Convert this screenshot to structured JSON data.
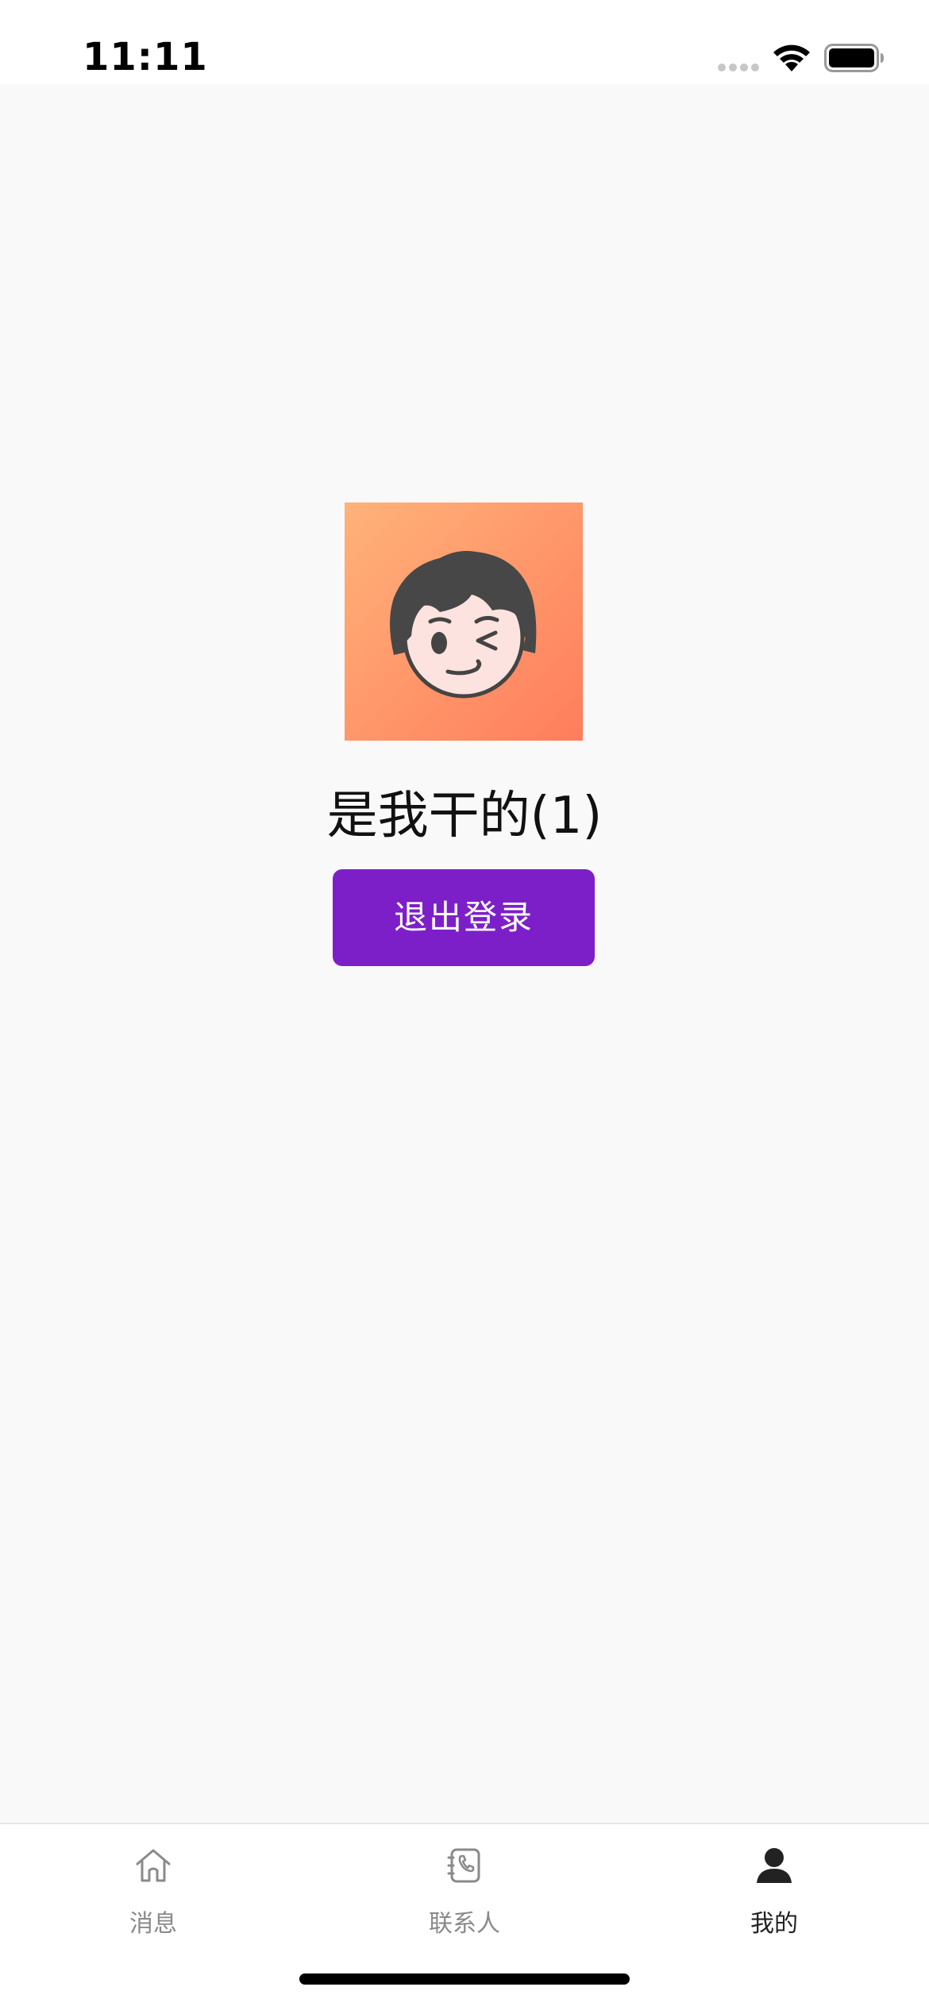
{
  "status_bar": {
    "time": "11:11"
  },
  "profile": {
    "username": "是我干的(1)",
    "logout_label": "退出登录",
    "avatar_icon": "winking-boy-avatar"
  },
  "tab_bar": {
    "items": [
      {
        "label": "消息",
        "icon": "home-icon",
        "active": false
      },
      {
        "label": "联系人",
        "icon": "contacts-phone-icon",
        "active": false
      },
      {
        "label": "我的",
        "icon": "person-icon",
        "active": true
      }
    ]
  },
  "colors": {
    "accent": "#7d1fc9",
    "background": "#f9f9f9",
    "tab_inactive": "#8a8a8a",
    "tab_active": "#222222"
  }
}
